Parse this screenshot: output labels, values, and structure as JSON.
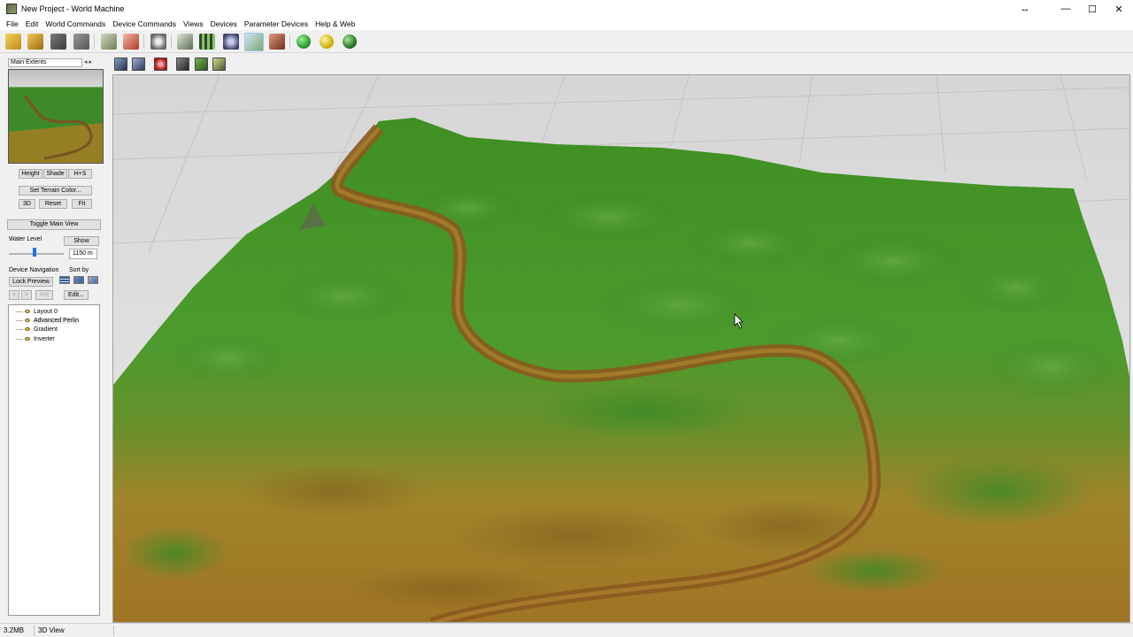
{
  "window": {
    "title": "New Project - World Machine",
    "resize_glyph": "↔",
    "minimize_glyph": "—",
    "maximize_glyph": "☐",
    "close_glyph": "✕"
  },
  "menu": [
    "File",
    "Edit",
    "World Commands",
    "Device Commands",
    "Views",
    "Devices",
    "Parameter Devices",
    "Help & Web"
  ],
  "toolbar_icons": [
    "new-project-icon",
    "open-icon",
    "save-icon",
    "settings-wand-icon",
    "terrain-edit-icon",
    "tools-icon",
    "film-reel-icon",
    "layout-view-icon",
    "film-strip-icon",
    "sphere-view-icon",
    "terrain-3d-view-icon",
    "texture-view-icon",
    "build-green-orb-icon",
    "build-yellow-orb-icon",
    "build-globe-icon"
  ],
  "view_toolbar_icons": [
    "ortho-view-icon",
    "perspective-view-icon",
    "render-icon",
    "camera-icon",
    "draw-path-icon",
    "help-query-icon"
  ],
  "left_panel": {
    "extents_value": "Main Extents",
    "extents_arrows": "◂ ▸",
    "height_btn": "Height",
    "shade_btn": "Shade",
    "hs_btn": "H+S",
    "set_color_btn": "Set Terrain Color...",
    "btn_3d": "3D",
    "reset_btn": "Reset",
    "fit_btn": "Fit",
    "toggle_main_view": "Toggle Main View",
    "water_level_label": "Water Level",
    "show_btn": "Show",
    "water_level_value": "1150 m",
    "device_nav_label": "Device Navigation",
    "sort_by_label": "Sort by",
    "lock_preview_btn": "Lock Preview",
    "nav_prev": "<",
    "nav_next": ">",
    "nav_last": ">>|",
    "edit_btn": "Edit...",
    "devices": [
      "Layout 0",
      "Advanced Perlin",
      "Gradient",
      "Inverter"
    ],
    "selected_device": "Advanced Perlin"
  },
  "status": {
    "memory": "3.2MB",
    "view_mode": "3D View"
  },
  "colors": {
    "grass_green": "#4e9a2e",
    "dark_green": "#2f7a1c",
    "soil_brown": "#a57c23",
    "river_brown": "#8a5a1e",
    "grid_floor": "#d8d8d8"
  }
}
